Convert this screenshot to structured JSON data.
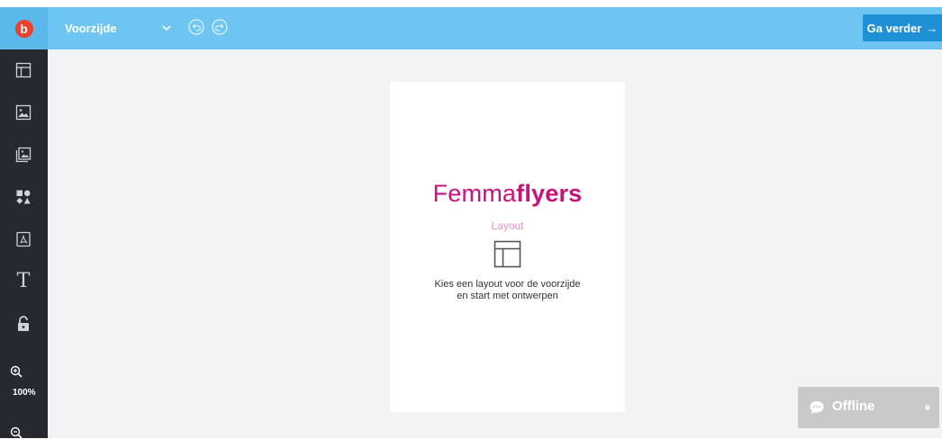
{
  "header": {
    "logo_letter": "b",
    "page_selector_label": "Voorzijde",
    "continue_label": "Ga verder",
    "continue_arrow": "→"
  },
  "sidebar": {
    "tools": [
      {
        "name": "layout-icon"
      },
      {
        "name": "image-icon"
      },
      {
        "name": "gallery-icon"
      },
      {
        "name": "shapes-icon"
      },
      {
        "name": "pdf-icon"
      },
      {
        "name": "text-icon",
        "glyph": "T"
      },
      {
        "name": "lock-icon"
      }
    ],
    "zoom_level": "100%"
  },
  "canvas": {
    "brand_light": "Femma",
    "brand_bold": "flyers",
    "layout_caption": "Layout",
    "instruction_line1": "Kies een layout voor de voorzijde",
    "instruction_line2": "en start met ontwerpen"
  },
  "chat": {
    "status_label": "Offline"
  },
  "colors": {
    "topbar": "#6ec5f2",
    "cta": "#1f8fd6",
    "sidebar": "#262a30",
    "brand": "#c8127a",
    "logo_badge": "#e8412e"
  }
}
